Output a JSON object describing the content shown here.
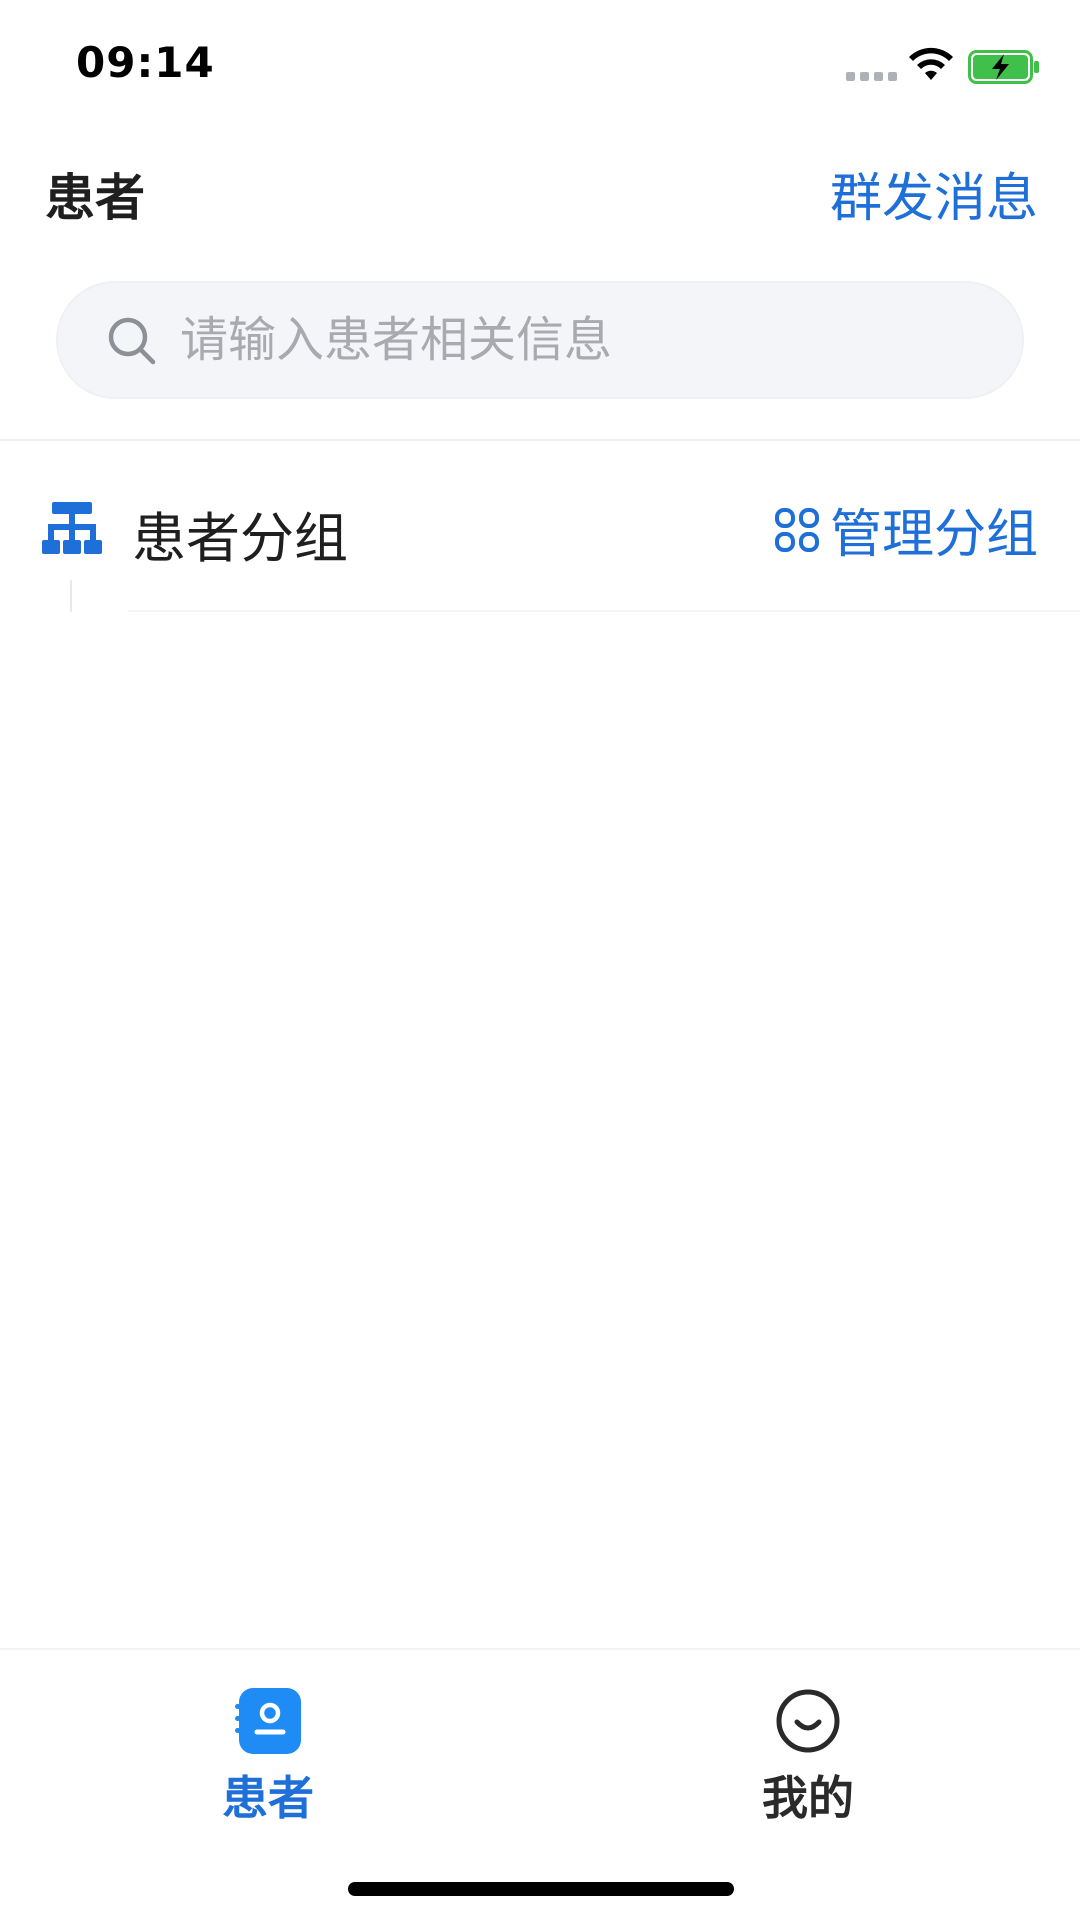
{
  "status_bar": {
    "time": "09:14",
    "signal_icon": "signal-dots-icon",
    "wifi_icon": "wifi-icon",
    "battery_icon": "battery-charging-icon",
    "battery_color": "#3fc04a"
  },
  "header": {
    "title": "患者",
    "broadcast_label": "群发消息"
  },
  "search": {
    "placeholder": "请输入患者相关信息",
    "value": "",
    "icon": "search-icon"
  },
  "groups": {
    "title": "患者分组",
    "title_icon": "group-tree-icon",
    "manage_label": "管理分组",
    "manage_icon": "grid-icon"
  },
  "tabs": [
    {
      "label": "患者",
      "icon": "patient-card-icon",
      "active": true
    },
    {
      "label": "我的",
      "icon": "smile-icon",
      "active": false
    }
  ],
  "colors": {
    "accent": "#1f6fd8",
    "text": "#1f1f1f",
    "placeholder": "#a8aab0",
    "search_bg": "#f4f5f8"
  }
}
